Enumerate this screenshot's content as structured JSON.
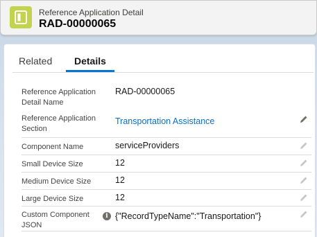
{
  "header": {
    "object_label": "Reference Application Detail",
    "record_name": "RAD-00000065"
  },
  "tabs": [
    {
      "label": "Related",
      "active": false
    },
    {
      "label": "Details",
      "active": true
    }
  ],
  "fields": [
    {
      "label": "Reference Application Detail Name",
      "value": "RAD-00000065",
      "editable": false
    },
    {
      "label": "Reference Application Section",
      "value": "Transportation Assistance",
      "editable": true,
      "link": true
    },
    {
      "label": "Component Name",
      "value": "serviceProviders",
      "editable": true
    },
    {
      "label": "Small Device Size",
      "value": "12",
      "editable": true
    },
    {
      "label": "Medium Device Size",
      "value": "12",
      "editable": true
    },
    {
      "label": "Large Device Size",
      "value": "12",
      "editable": true
    },
    {
      "label": "Custom Component JSON",
      "value": "{\"RecordTypeName\":\"Transportation\"}",
      "editable": true,
      "info_icon": true
    }
  ],
  "icons": {
    "app": "record-icon",
    "edit": "pencil-icon",
    "info": "info-icon"
  },
  "colors": {
    "brand": "#0176d3",
    "link": "#0b6fc4",
    "app_icon": "#c2d44e"
  }
}
